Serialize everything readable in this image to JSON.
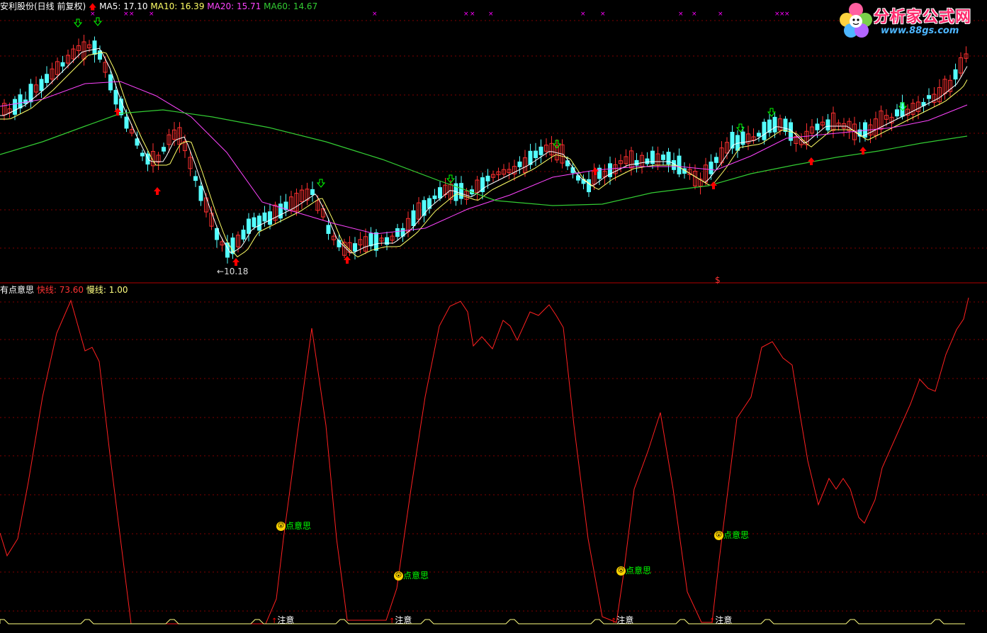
{
  "header": {
    "stock_title": "安利股份(日线 前复权)",
    "ma5": "MA5: 17.10",
    "ma10": "MA10: 16.39",
    "ma20": "MA20: 15.71",
    "ma60": "MA60: 14.67"
  },
  "indicator": {
    "name": "有点意思",
    "fast_label": "快线: 73.60",
    "slow_label": "慢线: 1.00"
  },
  "annotations": {
    "low_price": "10.18",
    "dollar_marker": "$",
    "signal_text": "点意思",
    "signal_icon": "😲",
    "alert_text": "注意",
    "alert_icon": "↑"
  },
  "logo": {
    "title": "分析家公式网",
    "url": "www.88gs.com"
  },
  "colors": {
    "up_candle": "#ff3030",
    "down_candle": "#54ffff",
    "ma5": "#ffffff",
    "ma10": "#ffff66",
    "ma20": "#ff44ff",
    "ma60": "#33cc33",
    "fast_line": "#ff2020",
    "slow_line": "#ffff80",
    "grid": "#800000"
  }
}
